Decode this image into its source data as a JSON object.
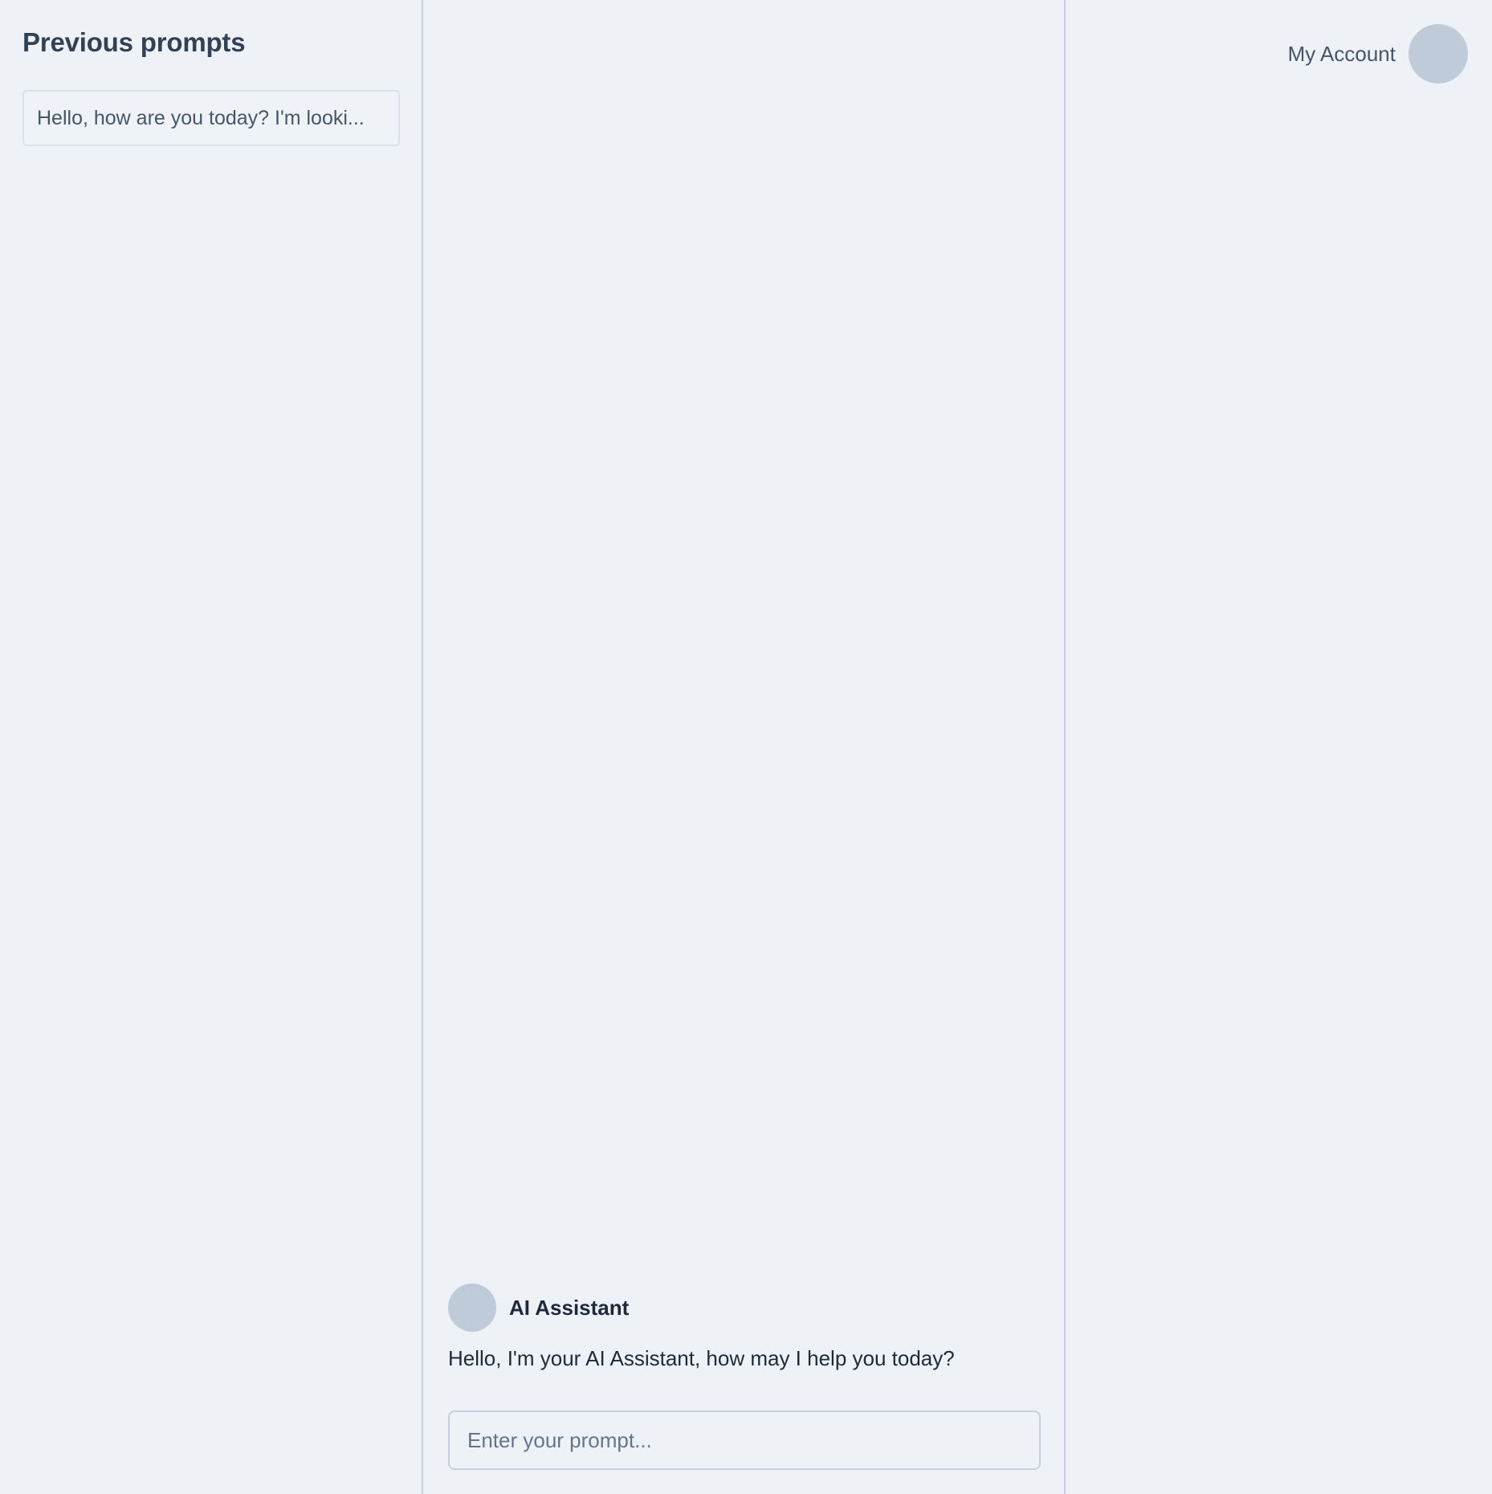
{
  "sidebar": {
    "title": "Previous prompts",
    "items": [
      {
        "label": "Hello, how are you today? I'm looki..."
      }
    ]
  },
  "chat": {
    "assistant": {
      "name": "AI Assistant",
      "message": "Hello, I'm your AI Assistant, how may I help you today?"
    },
    "input": {
      "placeholder": "Enter your prompt...",
      "value": ""
    }
  },
  "header": {
    "account_label": "My Account"
  },
  "colors": {
    "background": "#eef2f7",
    "divider": "#c6cfdb",
    "avatar": "#c0cbd9",
    "text_primary": "#1e293b",
    "text_secondary": "#475569"
  }
}
